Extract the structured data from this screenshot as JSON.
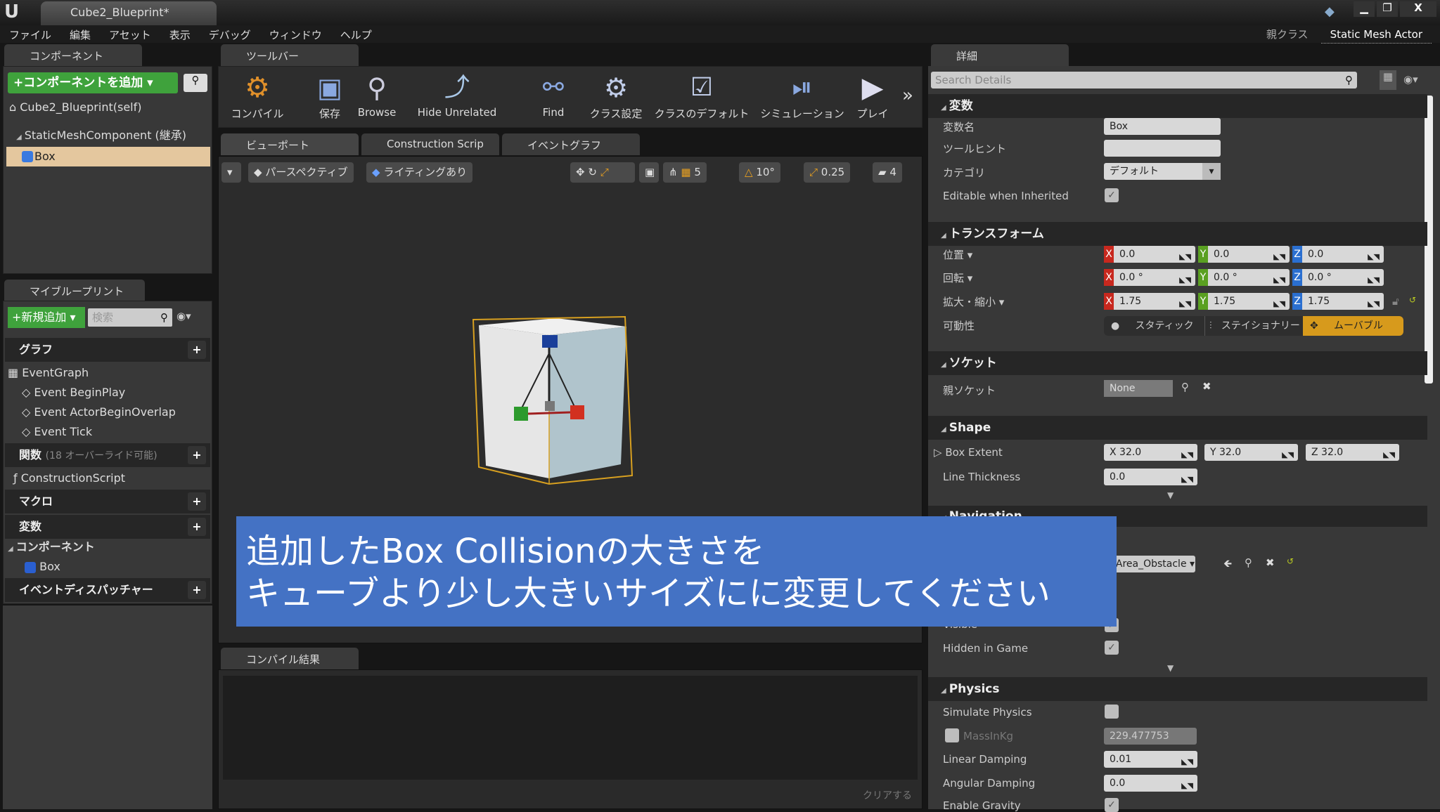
{
  "window": {
    "tab_title": "Cube2_Blueprint*",
    "parent_class_label": "親クラス",
    "parent_class": "Static Mesh Actor"
  },
  "menu": [
    "ファイル",
    "編集",
    "アセット",
    "表示",
    "デバッグ",
    "ウィンドウ",
    "ヘルプ"
  ],
  "components": {
    "tab": "コンポーネント",
    "add_button": "+コンポーネントを追加",
    "self": "Cube2_Blueprint(self)",
    "inherited": "StaticMeshComponent (継承)",
    "selected": "Box"
  },
  "toolbar": {
    "tab": "ツールバー",
    "buttons": [
      "コンパイル",
      "保存",
      "Browse",
      "Hide Unrelated",
      "Find",
      "クラス設定",
      "クラスのデフォルト",
      "シミュレーション",
      "プレイ"
    ]
  },
  "editor_tabs": [
    "ビューポート",
    "Construction Scrip",
    "イベントグラフ"
  ],
  "viewport": {
    "perspective": "パースペクティブ",
    "lighting": "ライティングあり",
    "grid_snap": "5",
    "rot_snap": "10°",
    "scale_snap": "0.25",
    "camera_speed": "4"
  },
  "my_blueprint": {
    "tab": "マイブループリント",
    "add_new": "新規追加",
    "search_placeholder": "検索",
    "graphs_header": "グラフ",
    "event_graph": "EventGraph",
    "events": [
      "Event BeginPlay",
      "Event ActorBeginOverlap",
      "Event Tick"
    ],
    "functions_header": "関数",
    "functions_note": "(18 オーバーライド可能)",
    "construction_script": "ConstructionScript",
    "macros_header": "マクロ",
    "variables_header": "変数",
    "components_header": "コンポーネント",
    "component_box": "Box",
    "dispatchers_header": "イベントディスパッチャー"
  },
  "compile": {
    "tab": "コンパイル結果",
    "clear": "クリアする"
  },
  "details": {
    "tab": "詳細",
    "search_placeholder": "Search Details",
    "variables": {
      "header": "変数",
      "name_label": "変数名",
      "name": "Box",
      "tooltip_label": "ツールヒント",
      "tooltip": "",
      "category_label": "カテゴリ",
      "category": "デフォルト",
      "editable_label": "Editable when Inherited",
      "editable": true
    },
    "transform": {
      "header": "トランスフォーム",
      "location_label": "位置",
      "rotation_label": "回転",
      "scale_label": "拡大・縮小",
      "location": [
        "0.0",
        "0.0",
        "0.0"
      ],
      "rotation": [
        "0.0 °",
        "0.0 °",
        "0.0 °"
      ],
      "scale": [
        "1.75",
        "1.75",
        "1.75"
      ],
      "mobility_label": "可動性",
      "mobility": [
        "スタティック",
        "ステイショナリー",
        "ムーバブル"
      ]
    },
    "sockets": {
      "header": "ソケット",
      "parent_label": "親ソケット",
      "parent": "None"
    },
    "shape": {
      "header": "Shape",
      "extent_label": "Box Extent",
      "extent": [
        "X  32.0",
        "Y  32.0",
        "Z  32.0"
      ],
      "thickness_label": "Line Thickness",
      "thickness": "0.0"
    },
    "navigation": {
      "header": "Navigation",
      "area": "avArea_Obstacle"
    },
    "rendering": {
      "visible_label": "Visible",
      "hidden_label": "Hidden in Game",
      "hidden": true
    },
    "physics": {
      "header": "Physics",
      "simulate_label": "Simulate Physics",
      "simulate": false,
      "mass_label": "MassInKg",
      "mass": "229.477753",
      "linear_label": "Linear Damping",
      "linear": "0.01",
      "angular_label": "Angular Damping",
      "angular": "0.0",
      "gravity_label": "Enable Gravity"
    }
  },
  "subtitle": [
    "追加したBox Collisionの大きさを",
    "キューブより少し大きいサイズにに変更してください"
  ],
  "colors": {
    "green": "#3fa23c",
    "orange": "#d79a1c",
    "x": "#c8281e",
    "y": "#5aa021",
    "z": "#2a6fd0",
    "subtitle_bg": "#4472c4"
  }
}
